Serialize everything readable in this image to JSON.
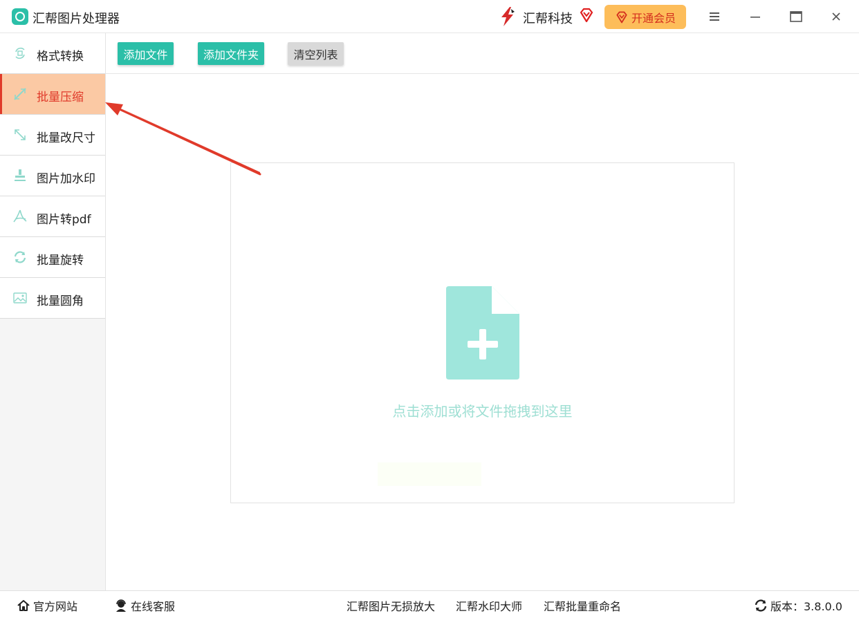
{
  "window": {
    "title": "汇帮图片处理器",
    "brand": "汇帮科技",
    "vip_button": "开通会员"
  },
  "sidebar": {
    "items": [
      {
        "label": "格式转换",
        "icon": "format-convert-icon",
        "active": false
      },
      {
        "label": "批量压缩",
        "icon": "compress-icon",
        "active": true
      },
      {
        "label": "批量改尺寸",
        "icon": "resize-icon",
        "active": false
      },
      {
        "label": "图片加水印",
        "icon": "watermark-icon",
        "active": false
      },
      {
        "label": "图片转pdf",
        "icon": "pdf-icon",
        "active": false
      },
      {
        "label": "批量旋转",
        "icon": "rotate-icon",
        "active": false
      },
      {
        "label": "批量圆角",
        "icon": "rounded-corner-icon",
        "active": false
      }
    ]
  },
  "toolbar": {
    "add_file": "添加文件",
    "add_folder": "添加文件夹",
    "clear_list": "清空列表"
  },
  "dropzone": {
    "hint": "点击添加或将文件拖拽到这里"
  },
  "footer": {
    "website": "官方网站",
    "support": "在线客服",
    "link1": "汇帮图片无损放大",
    "link2": "汇帮水印大师",
    "link3": "汇帮批量重命名",
    "version": "版本：3.8.0.0"
  },
  "colors": {
    "accent": "#2bbfa8",
    "active_bg": "#fbc9a4",
    "active_text": "#e03a2a",
    "vip_bg": "#fdbd5a",
    "arrow": "#e03a2a"
  }
}
